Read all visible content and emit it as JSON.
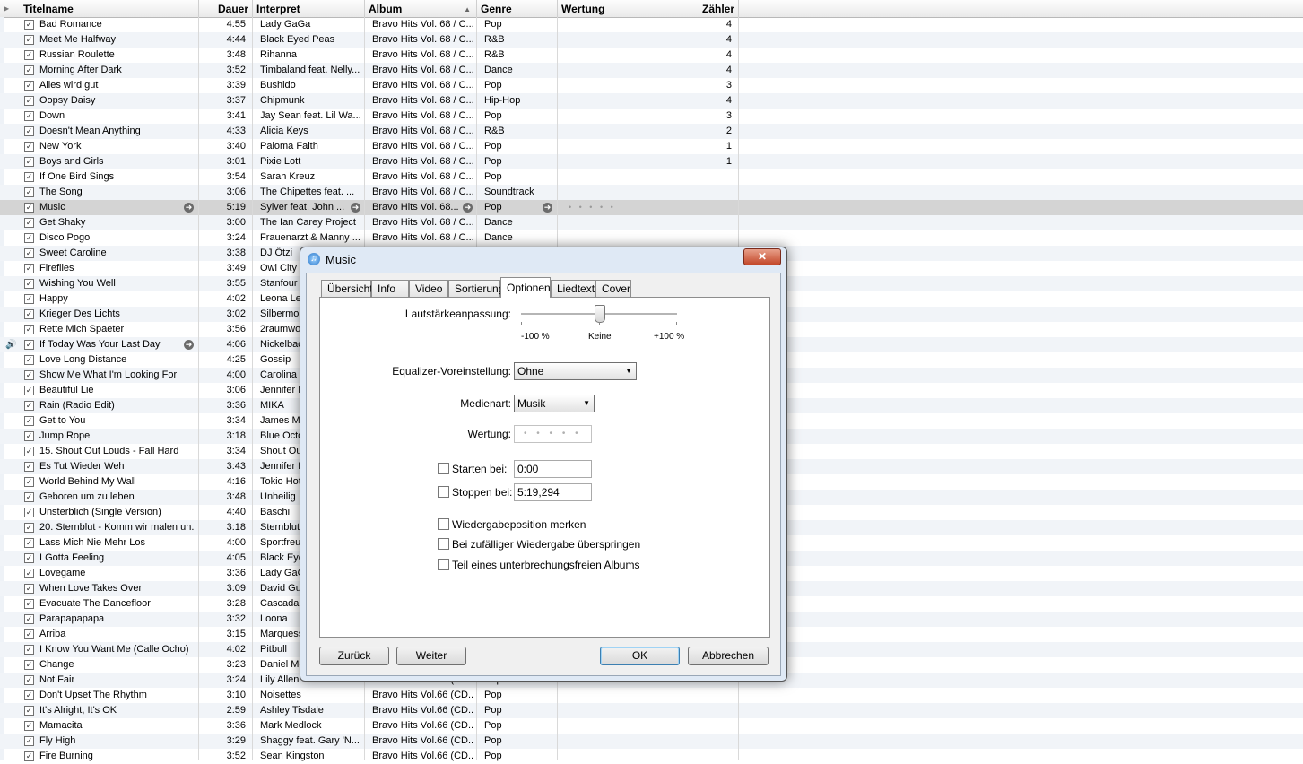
{
  "columns": [
    {
      "label": "Titelname"
    },
    {
      "label": "Dauer"
    },
    {
      "label": "Interpret"
    },
    {
      "label": "Album"
    },
    {
      "label": "Genre"
    },
    {
      "label": "Wertung"
    },
    {
      "label": "Zähler"
    }
  ],
  "rows": [
    {
      "title": "Bad Romance",
      "dur": "4:55",
      "artist": "Lady GaGa",
      "album": "Bravo Hits Vol. 68 / C...",
      "genre": "Pop",
      "count": "4"
    },
    {
      "title": "Meet Me Halfway",
      "dur": "4:44",
      "artist": "Black Eyed Peas",
      "album": "Bravo Hits Vol. 68 / C...",
      "genre": "R&B",
      "count": "4"
    },
    {
      "title": "Russian Roulette",
      "dur": "3:48",
      "artist": "Rihanna",
      "album": "Bravo Hits Vol. 68 / C...",
      "genre": "R&B",
      "count": "4"
    },
    {
      "title": "Morning After Dark",
      "dur": "3:52",
      "artist": "Timbaland feat. Nelly...",
      "album": "Bravo Hits Vol. 68 / C...",
      "genre": "Dance",
      "count": "4"
    },
    {
      "title": "Alles wird gut",
      "dur": "3:39",
      "artist": "Bushido",
      "album": "Bravo Hits Vol. 68 / C...",
      "genre": "Pop",
      "count": "3"
    },
    {
      "title": "Oopsy Daisy",
      "dur": "3:37",
      "artist": "Chipmunk",
      "album": "Bravo Hits Vol. 68 / C...",
      "genre": "Hip-Hop",
      "count": "4"
    },
    {
      "title": "Down",
      "dur": "3:41",
      "artist": "Jay Sean feat. Lil Wa...",
      "album": "Bravo Hits Vol. 68 / C...",
      "genre": "Pop",
      "count": "3"
    },
    {
      "title": "Doesn't Mean Anything",
      "dur": "4:33",
      "artist": "Alicia Keys",
      "album": "Bravo Hits Vol. 68 / C...",
      "genre": "R&B",
      "count": "2"
    },
    {
      "title": "New York",
      "dur": "3:40",
      "artist": "Paloma Faith",
      "album": "Bravo Hits Vol. 68 / C...",
      "genre": "Pop",
      "count": "1"
    },
    {
      "title": "Boys and Girls",
      "dur": "3:01",
      "artist": "Pixie Lott",
      "album": "Bravo Hits Vol. 68 / C...",
      "genre": "Pop",
      "count": "1"
    },
    {
      "title": "If One Bird Sings",
      "dur": "3:54",
      "artist": "Sarah Kreuz",
      "album": "Bravo Hits Vol. 68 / C...",
      "genre": "Pop",
      "count": ""
    },
    {
      "title": "The Song",
      "dur": "3:06",
      "artist": "The Chipettes feat. ...",
      "album": "Bravo Hits Vol. 68 / C...",
      "genre": "Soundtrack",
      "count": ""
    },
    {
      "title": "Music",
      "dur": "5:19",
      "artist": "Sylver feat. John ...",
      "album": "Bravo Hits Vol. 68...",
      "genre": "Pop",
      "count": "",
      "selected": true
    },
    {
      "title": "Get Shaky",
      "dur": "3:00",
      "artist": "The Ian Carey Project",
      "album": "Bravo Hits Vol. 68 / C...",
      "genre": "Dance",
      "count": ""
    },
    {
      "title": "Disco Pogo",
      "dur": "3:24",
      "artist": "Frauenarzt & Manny ...",
      "album": "Bravo Hits Vol. 68 / C...",
      "genre": "Dance",
      "count": ""
    },
    {
      "title": "Sweet Caroline",
      "dur": "3:38",
      "artist": "DJ Ötzi",
      "album": "",
      "genre": "",
      "count": ""
    },
    {
      "title": "Fireflies",
      "dur": "3:49",
      "artist": "Owl City",
      "album": "",
      "genre": "",
      "count": ""
    },
    {
      "title": "Wishing You Well",
      "dur": "3:55",
      "artist": "Stanfour",
      "album": "",
      "genre": "",
      "count": ""
    },
    {
      "title": "Happy",
      "dur": "4:02",
      "artist": "Leona Lew",
      "album": "",
      "genre": "",
      "count": ""
    },
    {
      "title": "Krieger Des Lichts",
      "dur": "3:02",
      "artist": "Silbermond",
      "album": "",
      "genre": "",
      "count": ""
    },
    {
      "title": "Rette Mich Spaeter",
      "dur": "3:56",
      "artist": "2raumwoh",
      "album": "",
      "genre": "",
      "count": ""
    },
    {
      "title": "If Today Was Your Last Day",
      "dur": "4:06",
      "artist": "Nickelback",
      "album": "",
      "genre": "",
      "count": "",
      "playing": true
    },
    {
      "title": "Love Long Distance",
      "dur": "4:25",
      "artist": "Gossip",
      "album": "",
      "genre": "",
      "count": ""
    },
    {
      "title": "Show Me What I'm Looking For",
      "dur": "4:00",
      "artist": "Carolina L",
      "album": "",
      "genre": "",
      "count": ""
    },
    {
      "title": "Beautiful Lie",
      "dur": "3:06",
      "artist": "Jennifer R",
      "album": "",
      "genre": "",
      "count": ""
    },
    {
      "title": "Rain (Radio Edit)",
      "dur": "3:36",
      "artist": "MIKA",
      "album": "",
      "genre": "",
      "count": ""
    },
    {
      "title": "Get to You",
      "dur": "3:34",
      "artist": "James Mo",
      "album": "",
      "genre": "",
      "count": ""
    },
    {
      "title": "Jump Rope",
      "dur": "3:18",
      "artist": "Blue Octo",
      "album": "",
      "genre": "",
      "count": ""
    },
    {
      "title": "15. Shout Out Louds - Fall Hard",
      "dur": "3:34",
      "artist": "Shout Out",
      "album": "",
      "genre": "",
      "count": ""
    },
    {
      "title": "Es Tut Wieder Weh",
      "dur": "3:43",
      "artist": "Jennifer R",
      "album": "",
      "genre": "",
      "count": ""
    },
    {
      "title": "World Behind My Wall",
      "dur": "4:16",
      "artist": "Tokio Hote",
      "album": "",
      "genre": "",
      "count": ""
    },
    {
      "title": " Geboren um zu leben",
      "dur": "3:48",
      "artist": "Unheilig",
      "album": "",
      "genre": "",
      "count": ""
    },
    {
      "title": "Unsterblich (Single Version)",
      "dur": "4:40",
      "artist": "Baschi",
      "album": "",
      "genre": "",
      "count": ""
    },
    {
      "title": "20. Sternblut - Komm wir malen un...",
      "dur": "3:18",
      "artist": "Sternblut",
      "album": "",
      "genre": "",
      "count": ""
    },
    {
      "title": "Lass Mich Nie Mehr Los",
      "dur": "4:00",
      "artist": "Sportfreu",
      "album": "",
      "genre": "",
      "count": ""
    },
    {
      "title": "I Gotta Feeling",
      "dur": "4:05",
      "artist": "Black Eye",
      "album": "",
      "genre": "",
      "count": ""
    },
    {
      "title": "Lovegame",
      "dur": "3:36",
      "artist": "Lady GaG",
      "album": "",
      "genre": "",
      "count": ""
    },
    {
      "title": "When Love Takes Over",
      "dur": "3:09",
      "artist": "David Gue",
      "album": "",
      "genre": "",
      "count": ""
    },
    {
      "title": "Evacuate The Dancefloor",
      "dur": "3:28",
      "artist": "Cascada",
      "album": "",
      "genre": "",
      "count": ""
    },
    {
      "title": "Parapapapapa",
      "dur": "3:32",
      "artist": "Loona",
      "album": "",
      "genre": "",
      "count": ""
    },
    {
      "title": "Arriba",
      "dur": "3:15",
      "artist": "Marquess",
      "album": "",
      "genre": "",
      "count": ""
    },
    {
      "title": "I Know You Want Me (Calle Ocho)",
      "dur": "4:02",
      "artist": "Pitbull",
      "album": "",
      "genre": "",
      "count": ""
    },
    {
      "title": "Change",
      "dur": "3:23",
      "artist": "Daniel Me",
      "album": "",
      "genre": "",
      "count": ""
    },
    {
      "title": "Not Fair",
      "dur": "3:24",
      "artist": "Lily Allen",
      "album": "Bravo Hits Vol.66 (CD...",
      "genre": "Pop",
      "count": ""
    },
    {
      "title": "Don't Upset The Rhythm",
      "dur": "3:10",
      "artist": "Noisettes",
      "album": "Bravo Hits Vol.66 (CD...",
      "genre": "Pop",
      "count": ""
    },
    {
      "title": "It's Alright, It's OK",
      "dur": "2:59",
      "artist": "Ashley Tisdale",
      "album": "Bravo Hits Vol.66 (CD...",
      "genre": "Pop",
      "count": ""
    },
    {
      "title": "Mamacita",
      "dur": "3:36",
      "artist": "Mark Medlock",
      "album": "Bravo Hits Vol.66 (CD...",
      "genre": "Pop",
      "count": ""
    },
    {
      "title": "Fly High",
      "dur": "3:29",
      "artist": "Shaggy feat. Gary 'N...",
      "album": "Bravo Hits Vol.66 (CD...",
      "genre": "Pop",
      "count": ""
    },
    {
      "title": "Fire Burning",
      "dur": "3:52",
      "artist": "Sean Kingston",
      "album": "Bravo Hits Vol.66 (CD...",
      "genre": "Pop",
      "count": ""
    }
  ],
  "selected_rating_dots": "• • • • •",
  "dialog": {
    "title": "Music",
    "close": "✕",
    "tabs": [
      "Übersicht",
      "Info",
      "Video",
      "Sortierung",
      "Optionen",
      "Liedtext",
      "Cover"
    ],
    "active_tab": "Optionen",
    "volume_label": "Lautstärkeanpassung:",
    "volume_min": "-100 %",
    "volume_mid": "Keine",
    "volume_max": "+100 %",
    "volume_value_percent": 0,
    "eq_label": "Equalizer-Voreinstellung:",
    "eq_value": "Ohne",
    "media_label": "Medienart:",
    "media_value": "Musik",
    "rating_label": "Wertung:",
    "rating_dots": "• • • • •",
    "start_label": "Starten bei:",
    "start_value": "0:00",
    "stop_label": "Stoppen bei:",
    "stop_value": "5:19,294",
    "remember_label": "Wiedergabeposition merken",
    "skip_label": "Bei zufälliger Wiedergabe überspringen",
    "gapless_label": "Teil eines unterbrechungsfreien Albums",
    "btn_back": "Zurück",
    "btn_next": "Weiter",
    "btn_ok": "OK",
    "btn_cancel": "Abbrechen"
  }
}
